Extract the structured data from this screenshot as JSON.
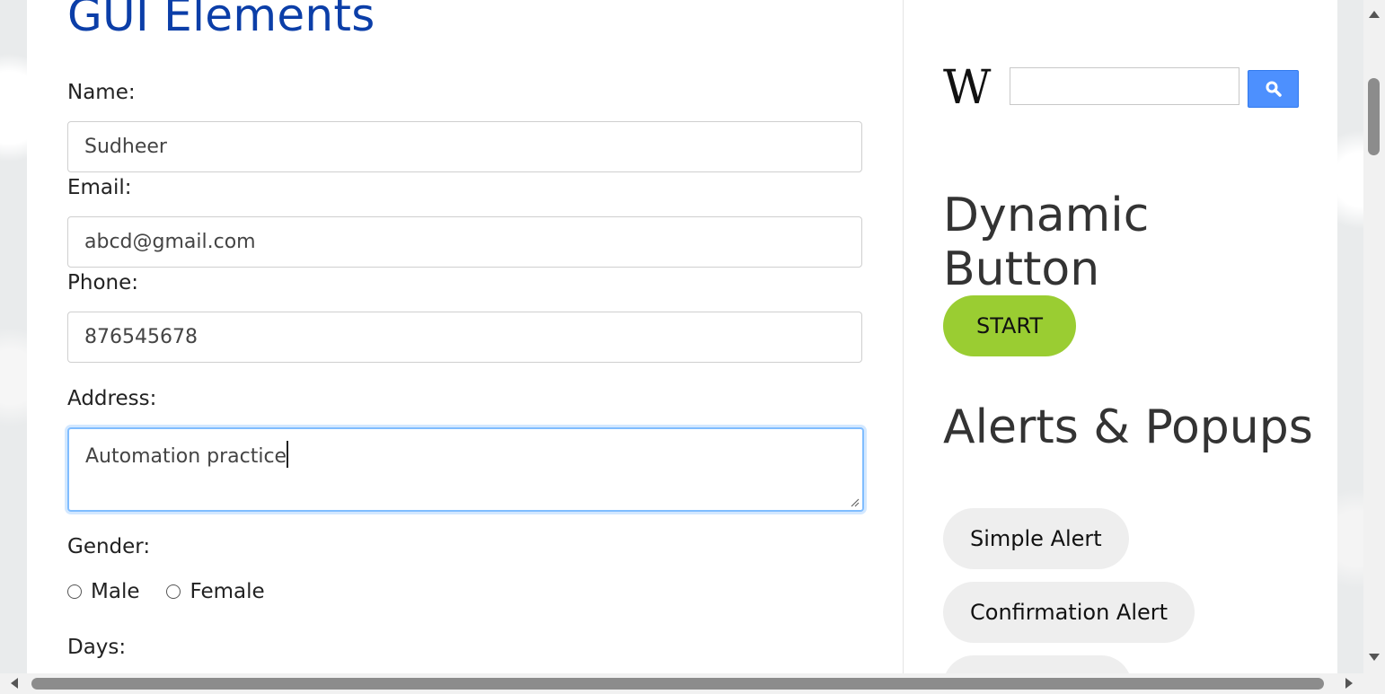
{
  "main": {
    "title": "GUI Elements",
    "name_label": "Name:",
    "name_value": "Sudheer",
    "email_label": "Email:",
    "email_value": "abcd@gmail.com",
    "phone_label": "Phone:",
    "phone_value": "876545678",
    "address_label": "Address:",
    "address_value": "Automation practice",
    "gender_label": "Gender:",
    "gender_options": [
      "Male",
      "Female"
    ],
    "days_label": "Days:"
  },
  "sidebar": {
    "wikipedia_logo": "W",
    "wikipedia_search_value": "",
    "search_icon": "magnifier-icon",
    "search_button_color": "#4d90fe",
    "dynamic_button_title": "Dynamic Button",
    "start_label": "START",
    "start_color": "#9acd32",
    "alerts_title": "Alerts & Popups",
    "simple_alert_label": "Simple Alert",
    "confirmation_alert_label": "Confirmation Alert"
  },
  "colors": {
    "title_blue": "#0b3ea8",
    "focus_border": "#80bdff"
  }
}
